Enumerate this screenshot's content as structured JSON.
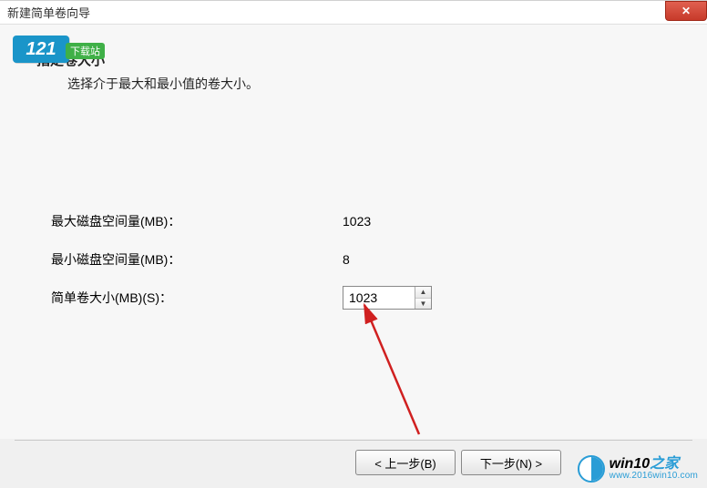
{
  "window": {
    "title": "新建简单卷向导"
  },
  "overlay": {
    "badge_num": "121",
    "badge_text": "下载站"
  },
  "header": {
    "heading": "指定卷大小",
    "subheading": "选择介于最大和最小值的卷大小。"
  },
  "form": {
    "max_label": "最大磁盘空间量(MB)：",
    "max_value": "1023",
    "min_label": "最小磁盘空间量(MB)：",
    "min_value": "8",
    "size_label": "简单卷大小(MB)(S)：",
    "size_value": "1023"
  },
  "buttons": {
    "back": "< 上一步(B)",
    "next": "下一步(N) >"
  },
  "watermark": {
    "brand_black": "win10",
    "brand_blue": "之家",
    "url": "www.2016win10.com"
  }
}
